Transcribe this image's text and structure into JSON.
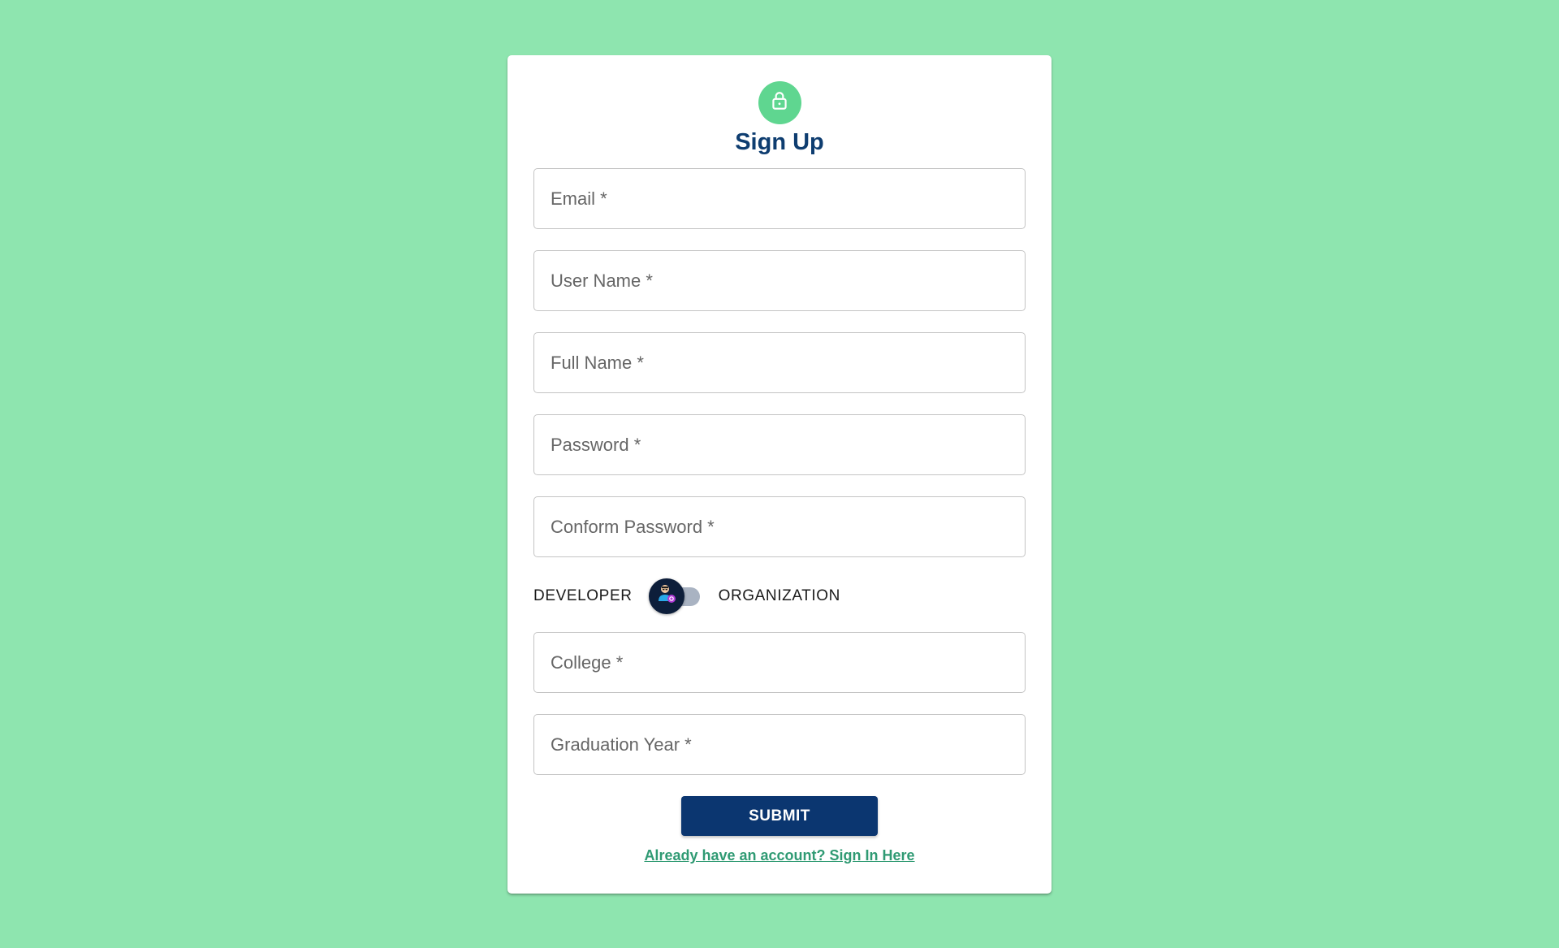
{
  "form": {
    "title": "Sign Up",
    "lock_icon": "lock-icon",
    "fields_top": [
      {
        "placeholder": "Email *"
      },
      {
        "placeholder": "User Name *"
      },
      {
        "placeholder": "Full Name *"
      },
      {
        "placeholder": "Password *"
      },
      {
        "placeholder": "Conform Password *"
      }
    ],
    "toggle": {
      "left_label": "DEVELOPER",
      "right_label": "ORGANIZATION",
      "state": "developer",
      "thumb_icon": "developer-avatar-icon"
    },
    "fields_bottom": [
      {
        "placeholder": "College *"
      },
      {
        "placeholder": "Graduation Year *"
      }
    ],
    "submit_label": "SUBMIT",
    "signin_link": "Already have an account? Sign In Here"
  },
  "colors": {
    "background": "#8ee5af",
    "accent": "#5fd690",
    "primary": "#0b3670",
    "link": "#2f9a73"
  }
}
